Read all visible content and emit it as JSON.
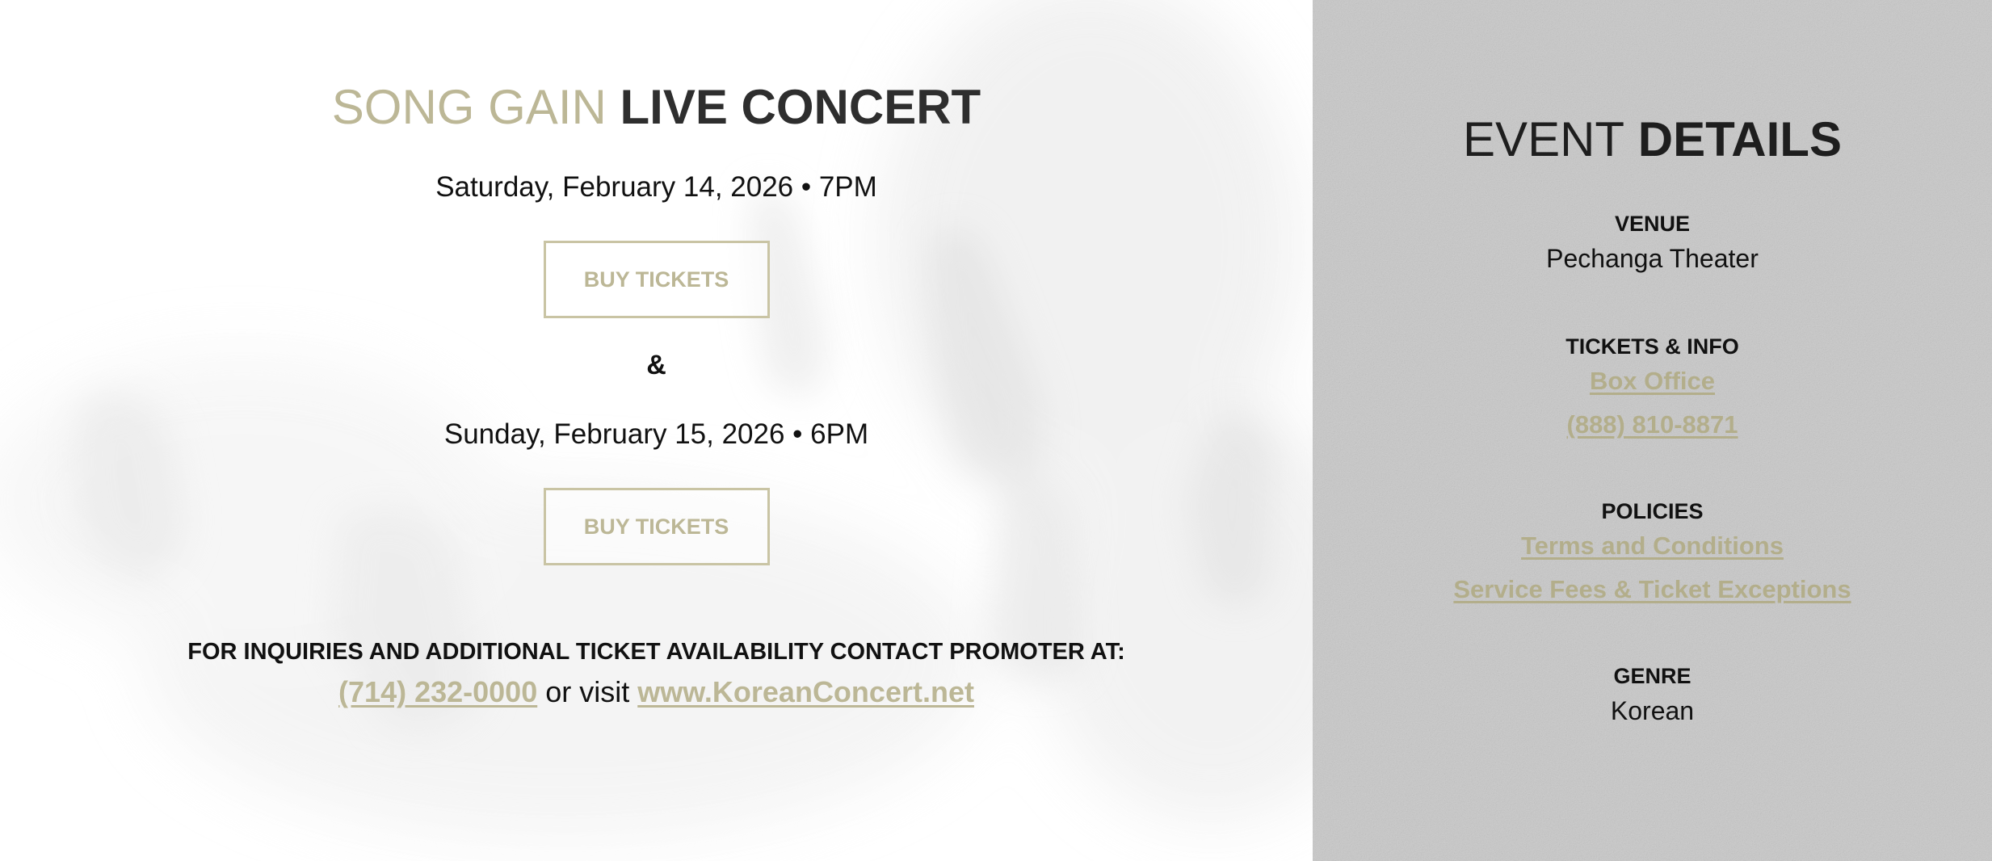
{
  "colors": {
    "accent_gold": "#bcb796",
    "dark_text": "#2e2e2e",
    "side_panel_bg": "#c9c9c9"
  },
  "event": {
    "title_light": "SONG GAIN",
    "title_bold": "LIVE CONCERT",
    "shows": [
      {
        "date_text": "Saturday, February 14, 2026 • 7PM",
        "button_label": "BUY TICKETS"
      },
      {
        "date_text": "Sunday, February 15, 2026 • 6PM",
        "button_label": "BUY TICKETS"
      }
    ],
    "separator": "&"
  },
  "inquiry": {
    "heading": "FOR INQUIRIES AND ADDITIONAL TICKET AVAILABILITY CONTACT PROMOTER AT:",
    "phone_link": "(714) 232-0000",
    "middle_text": " or visit ",
    "website_link": "www.KoreanConcert.net"
  },
  "details": {
    "title_light": "EVENT",
    "title_bold": "DETAILS",
    "venue": {
      "label": "VENUE",
      "value": "Pechanga Theater"
    },
    "tickets": {
      "label": "TICKETS & INFO",
      "links": [
        "Box Office",
        "(888) 810-8871"
      ]
    },
    "policies": {
      "label": "POLICIES",
      "links": [
        "Terms and Conditions",
        "Service Fees & Ticket Exceptions"
      ]
    },
    "genre": {
      "label": "GENRE",
      "value": "Korean"
    }
  }
}
